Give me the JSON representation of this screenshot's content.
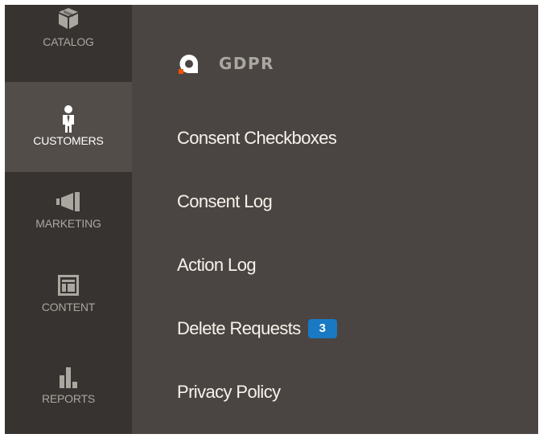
{
  "sidebar": {
    "items": [
      {
        "label": "CATALOG",
        "icon": "box-icon",
        "active": false
      },
      {
        "label": "CUSTOMERS",
        "icon": "person-icon",
        "active": true
      },
      {
        "label": "MARKETING",
        "icon": "megaphone-icon",
        "active": false
      },
      {
        "label": "CONTENT",
        "icon": "layout-icon",
        "active": false
      },
      {
        "label": "REPORTS",
        "icon": "bar-chart-icon",
        "active": false
      }
    ]
  },
  "panel": {
    "title": "GDPR",
    "logo_icon": "amasty-logo-icon",
    "items": [
      {
        "label": "Consent Checkboxes"
      },
      {
        "label": "Consent Log"
      },
      {
        "label": "Action Log"
      },
      {
        "label": "Delete Requests",
        "badge": "3"
      },
      {
        "label": "Privacy Policy"
      }
    ]
  },
  "colors": {
    "sidebar_bg": "#373330",
    "sidebar_active_bg": "#524d49",
    "panel_bg": "#4a4542",
    "badge_bg": "#1979c3",
    "logo_accent": "#eb5202"
  }
}
